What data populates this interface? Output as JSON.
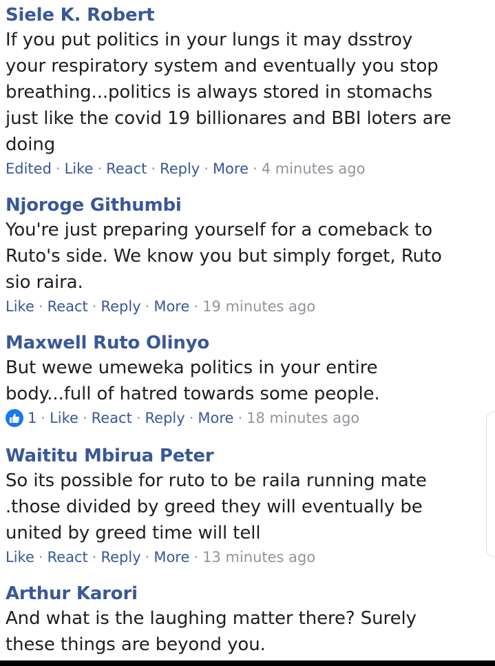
{
  "comments": [
    {
      "author": "Siele K. Robert",
      "text": "If you put politics in your lungs it may dsstroy\nyour respiratory system and eventually you stop\nbreathing...politics is always stored in stomachs\njust like the covid 19 billionares and BBI loters are\ndoing",
      "edited": "Edited",
      "like": "Like",
      "react": "React",
      "reply": "Reply",
      "more": "More",
      "time": "4 minutes ago",
      "sep": "·"
    },
    {
      "author": "Njoroge Githumbi",
      "text": "You're just preparing yourself for a comeback to\nRuto's side. We know you but simply forget, Ruto\nsio raira.",
      "like": "Like",
      "react": "React",
      "reply": "Reply",
      "more": "More",
      "time": "19 minutes ago",
      "sep": "·"
    },
    {
      "author": "Maxwell Ruto Olinyo",
      "text": "But wewe umeweka politics in your entire\nbody...full of hatred towards some people.",
      "reaction_count": "1",
      "reaction_icon": "thumbs-up-icon",
      "like": "Like",
      "react": "React",
      "reply": "Reply",
      "more": "More",
      "time": "18 minutes ago",
      "sep": "·"
    },
    {
      "author": "Waititu Mbirua Peter",
      "text": "So its possible for ruto to be raila running mate\n.those divided by greed they will eventually be\nunited by greed time will tell",
      "like": "Like",
      "react": "React",
      "reply": "Reply",
      "more": "More",
      "time": "13 minutes ago",
      "sep": "·"
    },
    {
      "author": "Arthur Karori",
      "text": "And what is the laughing matter there? Surely\nthese things are beyond you."
    }
  ],
  "colors": {
    "link": "#385898",
    "text": "#1c1e21",
    "meta": "#90949c",
    "like_badge": "#1877f2"
  }
}
